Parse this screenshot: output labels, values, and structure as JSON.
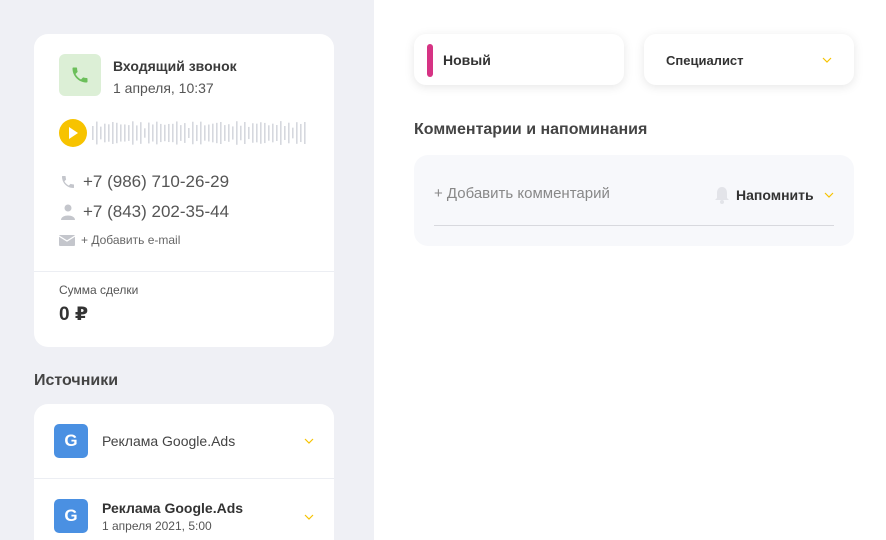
{
  "call": {
    "title": "Входящий звонок",
    "date": "1 апреля, 10:37",
    "phone_primary": "+7 (986) 710-26-29",
    "phone_secondary": "+7 (843) 202-35-44",
    "add_email": "+ Добавить e-mail",
    "icon": "phone-icon"
  },
  "deal": {
    "label": "Сумма сделки",
    "value": "0 ₽"
  },
  "sources": {
    "title": "Источники",
    "items": [
      {
        "label": "Реклама Google.Ads",
        "sub": ""
      },
      {
        "label": "Реклама Google.Ads",
        "sub": "1 апреля 2021, 5:00"
      }
    ],
    "badge_letter": "G"
  },
  "status": {
    "label": "Новый"
  },
  "specialist": {
    "label": "Специалист"
  },
  "comments": {
    "title": "Комментарии и напоминания",
    "placeholder": "+ Добавить комментарий",
    "remind_label": "Напомнить"
  },
  "colors": {
    "accent_yellow": "#f7c300",
    "status_pink": "#d63384",
    "google_blue": "#4a90e2",
    "call_green": "#dcefd6"
  }
}
